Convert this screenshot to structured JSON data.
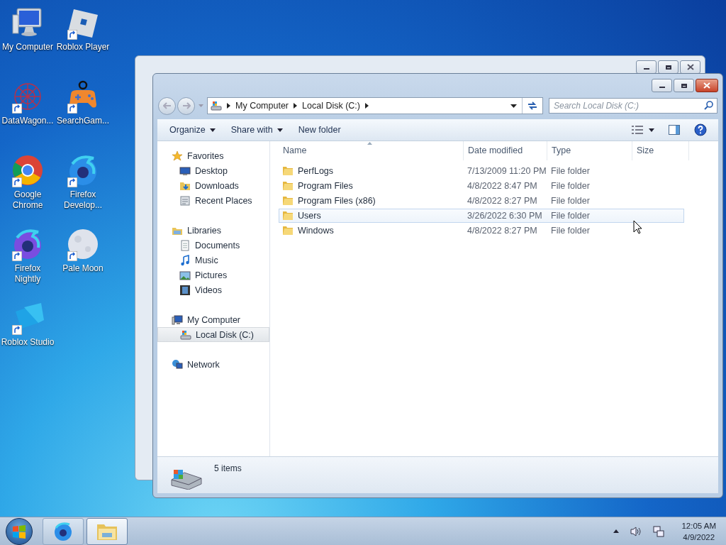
{
  "desktop_icons": [
    {
      "label": "My Computer",
      "kind": "computer",
      "shortcut": false
    },
    {
      "label": "Roblox Player",
      "kind": "roblox",
      "shortcut": true
    },
    {
      "label": "DataWagon...",
      "kind": "web",
      "shortcut": true
    },
    {
      "label": "SearchGam...",
      "kind": "gamepad",
      "shortcut": true
    },
    {
      "label": "Google Chrome",
      "kind": "chrome",
      "shortcut": true
    },
    {
      "label": "Firefox Develop...",
      "kind": "firefox-dev",
      "shortcut": true
    },
    {
      "label": "Firefox Nightly",
      "kind": "firefox-nightly",
      "shortcut": true
    },
    {
      "label": "Pale Moon",
      "kind": "moon",
      "shortcut": true
    },
    {
      "label": "Roblox Studio",
      "kind": "studio",
      "shortcut": true
    }
  ],
  "explorer": {
    "breadcrumbs": [
      "My Computer",
      "Local Disk (C:)"
    ],
    "search": {
      "placeholder": "Search Local Disk (C:)"
    },
    "toolbar": [
      {
        "label": "Organize",
        "dropdown": true
      },
      {
        "label": "Share with",
        "dropdown": true
      },
      {
        "label": "New folder",
        "dropdown": false
      }
    ],
    "nav": [
      {
        "label": "Favorites",
        "kind": "star",
        "selected": false,
        "children": [
          {
            "label": "Desktop",
            "kind": "desktop",
            "selected": false
          },
          {
            "label": "Downloads",
            "kind": "downloads",
            "selected": false
          },
          {
            "label": "Recent Places",
            "kind": "recent",
            "selected": false
          }
        ]
      },
      {
        "label": "Libraries",
        "kind": "libraries",
        "selected": false,
        "children": [
          {
            "label": "Documents",
            "kind": "documents",
            "selected": false
          },
          {
            "label": "Music",
            "kind": "music",
            "selected": false
          },
          {
            "label": "Pictures",
            "kind": "pictures",
            "selected": false
          },
          {
            "label": "Videos",
            "kind": "videos",
            "selected": false
          }
        ]
      },
      {
        "label": "My Computer",
        "kind": "computer",
        "selected": false,
        "children": [
          {
            "label": "Local Disk (C:)",
            "kind": "disk",
            "selected": true
          }
        ]
      },
      {
        "label": "Network",
        "kind": "network",
        "selected": false
      }
    ],
    "columns": [
      "Name",
      "Date modified",
      "Type",
      "Size"
    ],
    "rows": [
      {
        "name": "PerfLogs",
        "date": "7/13/2009 11:20 PM",
        "type": "File folder",
        "selected": false
      },
      {
        "name": "Program Files",
        "date": "4/8/2022 8:47 PM",
        "type": "File folder",
        "selected": false
      },
      {
        "name": "Program Files (x86)",
        "date": "4/8/2022 8:27 PM",
        "type": "File folder",
        "selected": false
      },
      {
        "name": "Users",
        "date": "3/26/2022 6:30 PM",
        "type": "File folder",
        "selected": true
      },
      {
        "name": "Windows",
        "date": "4/8/2022 8:27 PM",
        "type": "File folder",
        "selected": false
      }
    ],
    "status": "5 items"
  },
  "taskbar": {
    "items": [
      {
        "kind": "firefox",
        "active": false
      },
      {
        "kind": "explorer",
        "active": true
      }
    ],
    "time": "12:05 AM",
    "date": "4/9/2022"
  }
}
